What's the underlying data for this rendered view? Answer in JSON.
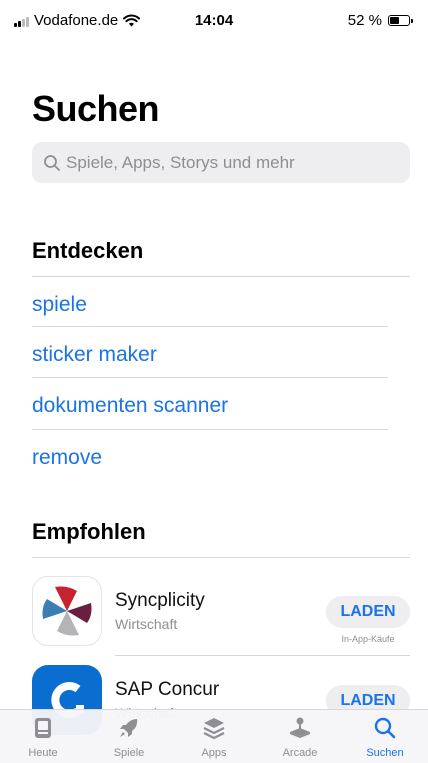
{
  "status_bar": {
    "carrier": "Vodafone.de",
    "time": "14:04",
    "battery": "52 %",
    "battery_level": 0.52
  },
  "page": {
    "title": "Suchen"
  },
  "search": {
    "placeholder": "Spiele, Apps, Storys und mehr",
    "icon": "search-icon"
  },
  "discover": {
    "heading": "Entdecken",
    "items": [
      {
        "label": "spiele"
      },
      {
        "label": "sticker maker"
      },
      {
        "label": "dokumenten scanner"
      },
      {
        "label": "remove"
      }
    ]
  },
  "recommended": {
    "heading": "Empfohlen",
    "apps": [
      {
        "name": "Syncplicity",
        "category": "Wirtschaft",
        "button": "LADEN",
        "note": "In-App-Käufe"
      },
      {
        "name": "SAP Concur",
        "category": "Wirtschaft",
        "button": "LADEN"
      }
    ]
  },
  "tabbar": {
    "tabs": [
      {
        "label": "Heute",
        "icon": "today-icon"
      },
      {
        "label": "Spiele",
        "icon": "rocket-icon"
      },
      {
        "label": "Apps",
        "icon": "stack-icon"
      },
      {
        "label": "Arcade",
        "icon": "joystick-icon"
      },
      {
        "label": "Suchen",
        "icon": "search-icon",
        "active": true
      }
    ]
  },
  "colors": {
    "accent": "#1a73e8",
    "secondary_text": "#8e8e93",
    "field_background": "#eeeef0"
  }
}
